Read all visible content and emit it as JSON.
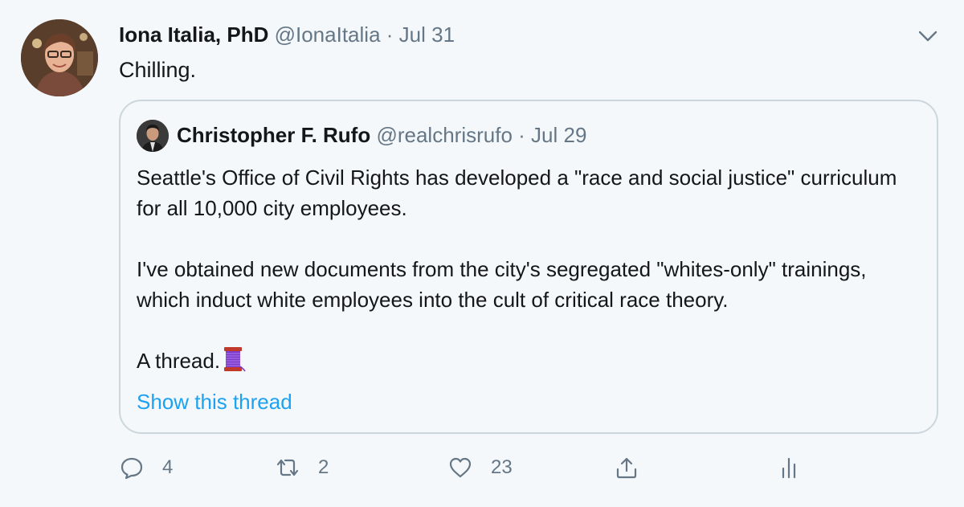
{
  "tweet": {
    "author_name": "Iona Italia, PhD",
    "author_handle": "@IonaItalia",
    "separator": "·",
    "date": "Jul 31",
    "text": "Chilling."
  },
  "quoted_tweet": {
    "author_name": "Christopher F. Rufo",
    "author_handle": "@realchrisrufo",
    "separator": "·",
    "date": "Jul 29",
    "paragraph_1": "Seattle's Office of Civil Rights has developed a \"race and social justice\" curriculum for all 10,000 city employees.",
    "paragraph_2": "I've obtained new documents from the city's segregated \"whites-only\" trainings, which induct white employees into the cult of critical race theory.",
    "paragraph_3": "A thread.",
    "show_thread_label": "Show this thread"
  },
  "actions": {
    "reply_count": "4",
    "retweet_count": "2",
    "like_count": "23"
  },
  "icons": {
    "more": "chevron-down-icon",
    "reply": "reply-icon",
    "retweet": "retweet-icon",
    "like": "heart-icon",
    "share": "share-icon",
    "analytics": "analytics-icon",
    "thread_emoji": "spool-of-thread-icon"
  },
  "colors": {
    "background": "#f5f8fa",
    "text": "#14171a",
    "secondary_text": "#657786",
    "link": "#1da1f2",
    "border": "#ccd6dd"
  }
}
